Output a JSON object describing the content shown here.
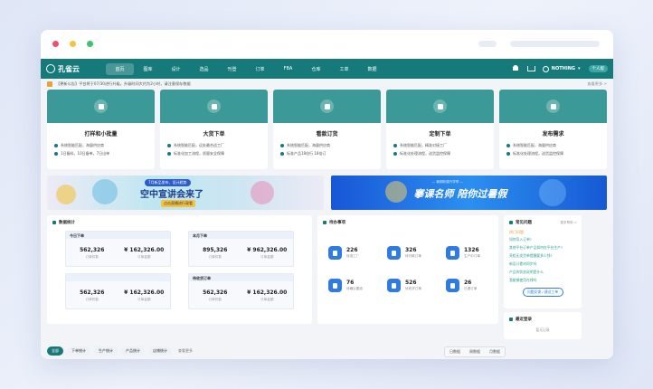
{
  "nav": {
    "logo": "孔雀云",
    "items": [
      "首页",
      "图库",
      "设计",
      "选品",
      "刊登",
      "订单",
      "FBA",
      "仓库",
      "工单",
      "数据"
    ],
    "active_index": 0,
    "user_name": "NOTHING",
    "personal_label": "个人版",
    "accent": "#177a7a"
  },
  "notice": {
    "text": "【更新公告】平台将于07/30进行升级。升级时间大约为2小时，请注意保存数据",
    "more": "查看更多 >"
  },
  "services": [
    {
      "title": "打样和小批量",
      "icon": "document-icon",
      "features": [
        "系统智能匹配，海量供应商",
        "1日备料，10日备单，7日出单"
      ]
    },
    {
      "title": "大货下单",
      "icon": "box-icon",
      "features": [
        "系统智能匹配，远处最合适工厂",
        "标准化加工流程，质量安全保障"
      ]
    },
    {
      "title": "看款订货",
      "icon": "calendar-icon",
      "features": [
        "系统智能匹配，海量供应商",
        "标准产品18倍行 18倍订"
      ]
    },
    {
      "title": "定制下单",
      "icon": "copy-icon",
      "features": [
        "系统智能匹配，精准对接工厂",
        "标准化处理流程，送货监控保障"
      ]
    },
    {
      "title": "发布需求",
      "icon": "send-icon",
      "features": [
        "系统智能匹配，海量供应商",
        "标准化处理流程，送货监控保障"
      ]
    }
  ],
  "banners": {
    "left_tag": "7月新品发布、设计趋势",
    "left_title": "空中宣讲会来了",
    "left_sub": "点击直播进行观看",
    "right_tag": "— 暑期新课开学季 —",
    "right_title": "搴课名师 陪你过暑假"
  },
  "stats": {
    "title": "数据统计",
    "boxes": [
      {
        "title": "今日下单",
        "count": "562,326",
        "count_label": "订单件数",
        "amount": "¥ 162,326.00",
        "amount_label": "订单金额"
      },
      {
        "title": "本月下单",
        "count": "895,326",
        "count_label": "订单件数",
        "amount": "¥ 962,326.00",
        "amount_label": "订单金额"
      },
      {
        "title": "",
        "count": "562,326",
        "count_label": "订单件数",
        "amount": "¥ 162,326.00",
        "amount_label": "订单金额"
      },
      {
        "title": "待收货订单",
        "count": "562,326",
        "count_label": "订单件数",
        "amount": "¥ 162,326.00",
        "amount_label": "订单金额"
      }
    ]
  },
  "todo": {
    "title": "待办事项",
    "items": [
      {
        "num": "226",
        "label": "待选工厂"
      },
      {
        "num": "326",
        "label": "待付款订单"
      },
      {
        "num": "1326",
        "label": "生产中订单"
      },
      {
        "num": "76",
        "label": "待确认图纸"
      },
      {
        "num": "526",
        "label": "待收货订单"
      },
      {
        "num": "26",
        "label": "已退订单"
      }
    ]
  },
  "faq": {
    "title": "常见问题",
    "more": "更多帮助 >",
    "hot": "热门问题",
    "items": [
      "如何导入订单?",
      "其他平台订单产品如何在平台生产?",
      "亮相无发货单提醒要多少钱?",
      "新设计素材同步吗",
      "产品的状态说明是什么",
      "我能够使用在线吗"
    ],
    "button": "问题反馈 / 建议工单"
  },
  "recent": {
    "title": "最近登录",
    "empty": "暂无记录"
  },
  "filters": {
    "chips": [
      "全部",
      "下单统计",
      "生产统计",
      "产品统计",
      "店铺统计"
    ],
    "active_index": 0,
    "extra": "查看更多",
    "periods": [
      "日数据",
      "周数据",
      "月数据"
    ]
  }
}
